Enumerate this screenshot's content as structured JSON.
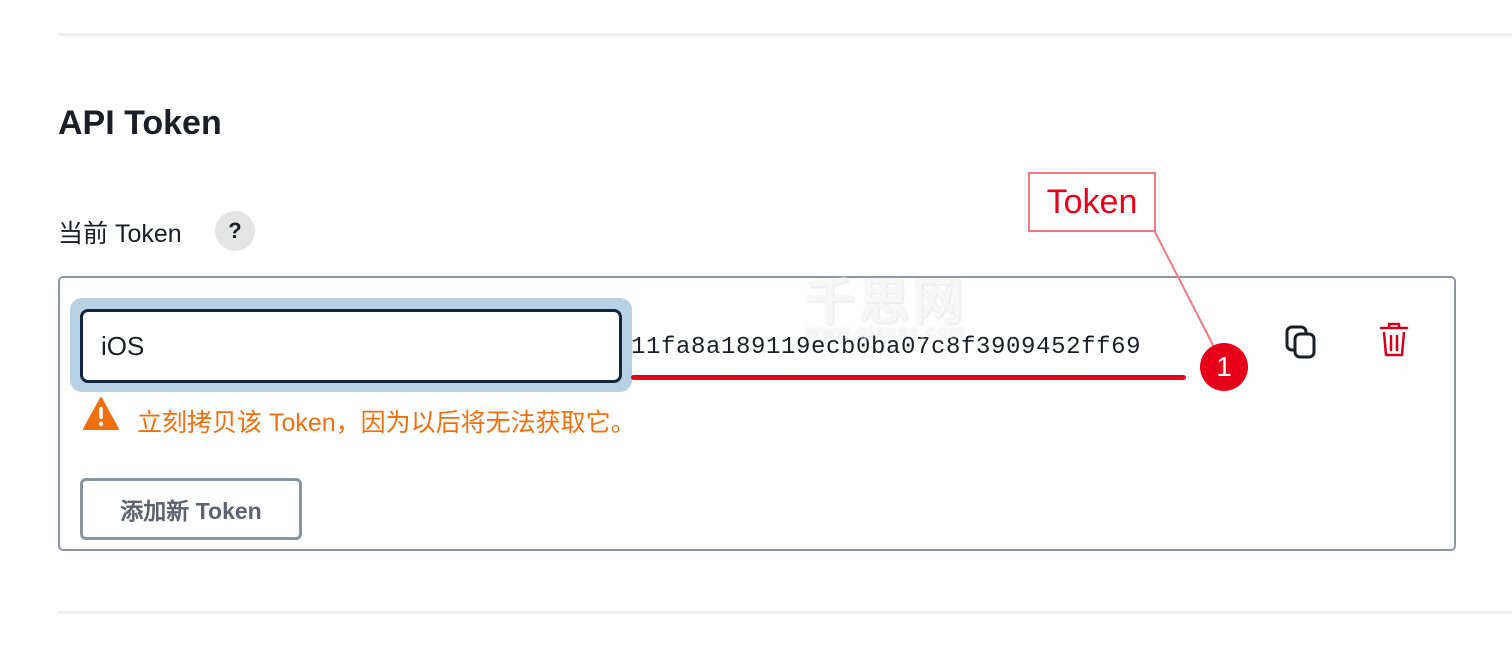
{
  "section": {
    "title": "API Token",
    "current_token_label": "当前 Token",
    "help_glyph": "?"
  },
  "token_row": {
    "name_value": "iOS",
    "token_value": "11fa8a189119ecb0ba07c8f3909452ff69",
    "copy_icon": "copy-icon",
    "delete_icon": "trash-icon"
  },
  "warning": {
    "icon": "warning-triangle-icon",
    "text": "立刻拷贝该 Token，因为以后将无法获取它。"
  },
  "actions": {
    "add_button_label": "添加新 Token"
  },
  "annotation": {
    "callout_label": "Token",
    "badge_number": "1"
  },
  "watermark": {
    "title": "千思网",
    "domain": "www.qianss.com"
  },
  "colors": {
    "warning": "#f0700f",
    "annotation_red": "#e6001a",
    "delete_red": "#d0021b",
    "focus_ring": "#b9d1e5"
  }
}
